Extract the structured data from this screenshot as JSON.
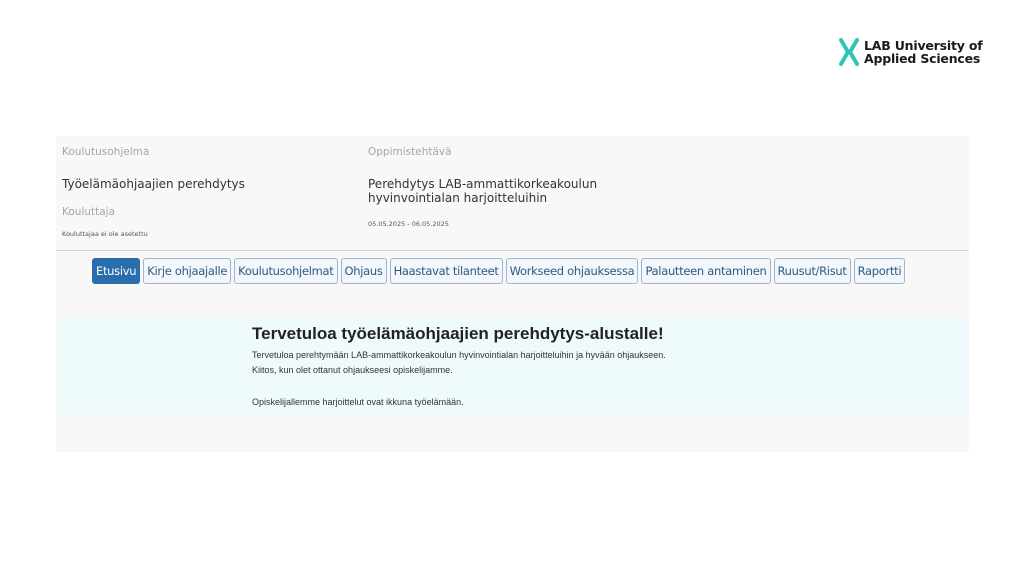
{
  "brand": {
    "line1": "LAB University of",
    "line2": "Applied Sciences",
    "accent_color": "#2ec4b6"
  },
  "course": {
    "program_label": "Koulutusohjelma",
    "program_value": "Työelämäohjaajien perehdytys",
    "trainer_label": "Kouluttaja",
    "trainer_value": "Kouluttajaa ei ole asetettu",
    "task_label": "Oppimistehtävä",
    "task_value_line1": "Perehdytys LAB-ammattikorkeakoulun",
    "task_value_line2": "hyvinvointialan harjoitteluihin",
    "dates": "05.05.2025 - 06.05.2025"
  },
  "nav": {
    "active_color": "#2a6dad",
    "tabs": [
      {
        "label": "Etusivu",
        "active": true
      },
      {
        "label": "Kirje ohjaajalle",
        "active": false
      },
      {
        "label": "Koulutusohjelmat",
        "active": false
      },
      {
        "label": "Ohjaus",
        "active": false
      },
      {
        "label": "Haastavat tilanteet",
        "active": false
      },
      {
        "label": "Workseed ohjauksessa",
        "active": false
      },
      {
        "label": "Palautteen antaminen",
        "active": false
      },
      {
        "label": "Ruusut/Risut",
        "active": false
      },
      {
        "label": "Raportti",
        "active": false
      }
    ]
  },
  "welcome": {
    "title": "Tervetuloa työelämäohjaajien perehdytys-alustalle!",
    "line1": "Tervetuloa perehtymään LAB-ammattikorkeakoulun hyvinvointialan harjoitteluihin ja hyvään ohjaukseen.",
    "line2": "Kiitos, kun olet ottanut ohjaukseesi opiskelijamme.",
    "line3": "Opiskelijallemme harjoittelut ovat ikkuna työelämään."
  }
}
